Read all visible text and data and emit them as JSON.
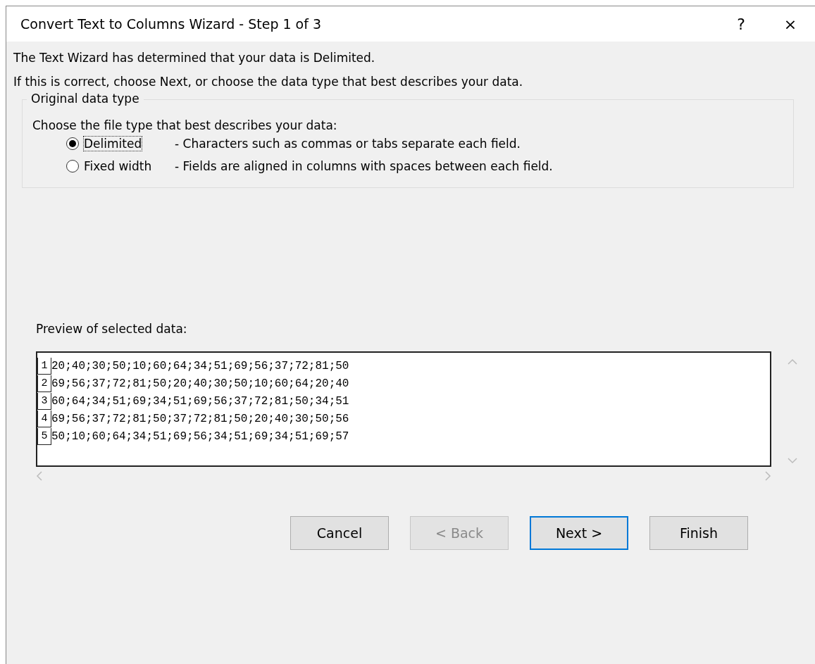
{
  "window": {
    "title": "Convert Text to Columns Wizard - Step 1 of 3",
    "help": "?",
    "close": "×"
  },
  "intro": [
    "The Text Wizard has determined that your data is Delimited.",
    "If this is correct, choose Next, or choose the data type that best describes your data."
  ],
  "group": {
    "title": "Original data type",
    "prompt": "Choose the file type that best describes your data:",
    "options": [
      {
        "label": "Delimited",
        "description": "- Characters such as commas or tabs separate each field.",
        "selected": true,
        "focused": true
      },
      {
        "label": "Fixed width",
        "description": "- Fields are aligned in columns with spaces between each field.",
        "selected": false,
        "focused": false
      }
    ]
  },
  "preview": {
    "label": "Preview of selected data:",
    "rows": [
      {
        "number": "1",
        "text": "20;40;30;50;10;60;64;34;51;69;56;37;72;81;50"
      },
      {
        "number": "2",
        "text": "69;56;37;72;81;50;20;40;30;50;10;60;64;20;40"
      },
      {
        "number": "3",
        "text": "60;64;34;51;69;34;51;69;56;37;72;81;50;34;51"
      },
      {
        "number": "4",
        "text": "69;56;37;72;81;50;37;72;81;50;20;40;30;50;56"
      },
      {
        "number": "5",
        "text": "50;10;60;64;34;51;69;56;34;51;69;34;51;69;57"
      }
    ]
  },
  "buttons": [
    {
      "label": "Cancel",
      "disabled": false,
      "default": false
    },
    {
      "label": "< Back",
      "disabled": true,
      "default": false
    },
    {
      "label": "Next >",
      "disabled": false,
      "default": true
    },
    {
      "label": "Finish",
      "disabled": false,
      "default": false
    }
  ]
}
